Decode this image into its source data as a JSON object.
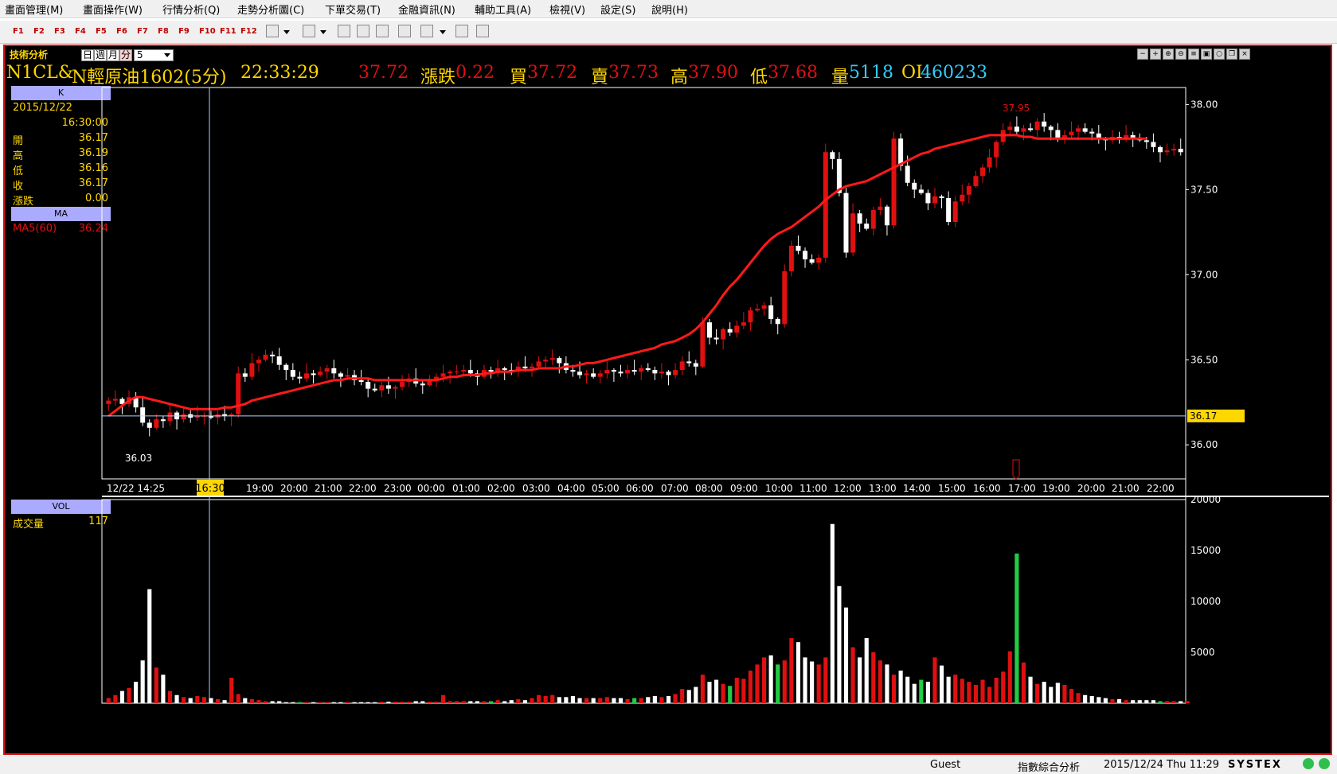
{
  "menu": [
    "畫面管理(M)",
    "畫面操作(W)",
    "行情分析(Q)",
    "走勢分析圖(C)",
    "下單交易(T)",
    "金融資訊(N)",
    "輔助工具(A)",
    "檢視(V)",
    "設定(S)",
    "說明(H)"
  ],
  "fkeys": [
    "F1",
    "F2",
    "F3",
    "F4",
    "F5",
    "F6",
    "F7",
    "F8",
    "F9",
    "F10",
    "F11",
    "F12"
  ],
  "panel_title": "技術分析",
  "timeframes": {
    "day": "日",
    "week": "週",
    "month": "月",
    "minute": "分",
    "interval": "5"
  },
  "quote": {
    "symbol": "N1CL&",
    "name": "N輕原油1602(5分)",
    "time": "22:33:29",
    "price": "37.72",
    "change_label": "漲跌",
    "change": "0.22",
    "bid_label": "買",
    "bid": "37.72",
    "ask_label": "賣",
    "ask": "37.73",
    "high_label": "高",
    "high": "37.90",
    "low_label": "低",
    "low": "37.68",
    "vol_label": "量",
    "vol": "5118",
    "oi_label": "OI",
    "oi": "460233"
  },
  "k_panel": {
    "title": "K",
    "date": "2015/12/22",
    "time": "16:30:00",
    "rows": [
      {
        "label": "開",
        "value": "36.17"
      },
      {
        "label": "高",
        "value": "36.19"
      },
      {
        "label": "低",
        "value": "36.16"
      },
      {
        "label": "收",
        "value": "36.17"
      },
      {
        "label": "漲跌",
        "value": "0.00"
      }
    ]
  },
  "ma_panel": {
    "title": "MA",
    "label": "MA5(60)",
    "value": "36.24"
  },
  "vol_panel": {
    "title": "VOL",
    "label": "成交量",
    "value": "117"
  },
  "status": {
    "user": "Guest",
    "mode": "指數綜合分析",
    "datetime": "2015/12/24 Thu 11:29",
    "brand": "SYSTEX"
  },
  "colors": {
    "up": "#e01010",
    "down": "#ffffff",
    "ma": "#ff1a1a",
    "accent": "#ffd700",
    "frame": "#e01010"
  },
  "chart_data": {
    "type": "candlestick",
    "price_ylim": [
      35.8,
      38.1
    ],
    "price_ticks": [
      "38.00",
      "37.50",
      "37.00",
      "36.50",
      "36.00"
    ],
    "current_price_tag": "36.17",
    "high_marker": "37.95",
    "low_marker": "36.03",
    "x_labels": [
      "12/22 14:25",
      "16:30",
      "19:00",
      "20:00",
      "21:00",
      "22:00",
      "23:00",
      "00:00",
      "01:00",
      "02:00",
      "03:00",
      "04:00",
      "05:00",
      "06:00",
      "07:00",
      "08:00",
      "09:00",
      "10:00",
      "11:00",
      "12:00",
      "13:00",
      "14:00",
      "15:00",
      "16:00",
      "17:00",
      "19:00",
      "20:00",
      "21:00",
      "22:00"
    ],
    "cursor_label": "16:30",
    "close_series": [
      36.26,
      36.27,
      36.24,
      36.28,
      36.22,
      36.13,
      36.1,
      36.15,
      36.14,
      36.19,
      36.15,
      36.18,
      36.16,
      36.17,
      36.17,
      36.16,
      36.18,
      36.17,
      36.18,
      36.42,
      36.4,
      36.48,
      36.5,
      36.53,
      36.52,
      36.47,
      36.44,
      36.4,
      36.39,
      36.42,
      36.41,
      36.43,
      36.45,
      36.42,
      36.4,
      36.41,
      36.38,
      36.37,
      36.33,
      36.32,
      36.35,
      36.33,
      36.34,
      36.37,
      36.39,
      36.36,
      36.35,
      36.38,
      36.4,
      36.42,
      36.43,
      36.43,
      36.44,
      36.42,
      36.4,
      36.44,
      36.43,
      36.45,
      36.44,
      36.43,
      36.46,
      36.45,
      36.46,
      36.49,
      36.5,
      36.51,
      36.48,
      36.44,
      36.43,
      36.41,
      36.42,
      36.4,
      36.42,
      36.44,
      36.43,
      36.42,
      36.44,
      36.43,
      36.45,
      36.44,
      36.42,
      36.43,
      36.41,
      36.44,
      36.49,
      36.48,
      36.46,
      36.72,
      36.63,
      36.62,
      36.68,
      36.66,
      36.7,
      36.72,
      36.79,
      36.8,
      36.82,
      36.74,
      36.71,
      37.02,
      37.17,
      37.14,
      37.09,
      37.07,
      37.1,
      37.72,
      37.68,
      37.48,
      37.13,
      37.36,
      37.3,
      37.27,
      37.38,
      37.4,
      37.29,
      37.8,
      37.64,
      37.54,
      37.5,
      37.48,
      37.42,
      37.46,
      37.45,
      37.31,
      37.43,
      37.47,
      37.52,
      37.58,
      37.63,
      37.69,
      37.78,
      37.85,
      37.87,
      37.84,
      37.86,
      37.85,
      37.9,
      37.87,
      37.85,
      37.8,
      37.82,
      37.84,
      37.86,
      37.84,
      37.83,
      37.8,
      37.79,
      37.81,
      37.8,
      37.82,
      37.8,
      37.79,
      37.78,
      37.75,
      37.72,
      37.73,
      37.74,
      37.72
    ],
    "ma_series": [
      36.17,
      36.2,
      36.23,
      36.26,
      36.28,
      36.28,
      36.27,
      36.26,
      36.25,
      36.24,
      36.23,
      36.22,
      36.21,
      36.21,
      36.21,
      36.21,
      36.21,
      36.22,
      36.22,
      36.23,
      36.24,
      36.26,
      36.27,
      36.28,
      36.29,
      36.3,
      36.31,
      36.32,
      36.33,
      36.34,
      36.35,
      36.36,
      36.37,
      36.38,
      36.38,
      36.39,
      36.39,
      36.39,
      36.39,
      36.38,
      36.38,
      36.38,
      36.38,
      36.38,
      36.38,
      36.38,
      36.38,
      36.38,
      36.38,
      36.39,
      36.4,
      36.4,
      36.41,
      36.41,
      36.41,
      36.42,
      36.42,
      36.43,
      36.43,
      36.43,
      36.44,
      36.44,
      36.44,
      36.45,
      36.45,
      36.45,
      36.45,
      36.46,
      36.46,
      36.47,
      36.48,
      36.48,
      36.49,
      36.5,
      36.51,
      36.52,
      36.53,
      36.54,
      36.55,
      36.56,
      36.57,
      36.59,
      36.6,
      36.61,
      36.63,
      36.65,
      36.68,
      36.72,
      36.77,
      36.82,
      36.88,
      36.93,
      36.97,
      37.02,
      37.07,
      37.12,
      37.17,
      37.21,
      37.24,
      37.26,
      37.28,
      37.31,
      37.34,
      37.37,
      37.4,
      37.44,
      37.47,
      37.5,
      37.52,
      37.53,
      37.54,
      37.55,
      37.57,
      37.59,
      37.61,
      37.63,
      37.65,
      37.67,
      37.69,
      37.71,
      37.72,
      37.74,
      37.75,
      37.76,
      37.77,
      37.78,
      37.79,
      37.8,
      37.81,
      37.82,
      37.82,
      37.82,
      37.82,
      37.82,
      37.81,
      37.81,
      37.8,
      37.8,
      37.8,
      37.8,
      37.8,
      37.8,
      37.8,
      37.8,
      37.8,
      37.8,
      37.8,
      37.8,
      37.8,
      37.8,
      37.8,
      37.8,
      37.8
    ],
    "vol_ylim": [
      0,
      20000
    ],
    "vol_ticks": [
      "20000",
      "15000",
      "10000",
      "5000"
    ],
    "vol_series": [
      500,
      800,
      1200,
      1500,
      2100,
      4200,
      11200,
      3500,
      2800,
      1200,
      800,
      600,
      500,
      700,
      600,
      500,
      400,
      300,
      2500,
      900,
      500,
      400,
      300,
      200,
      200,
      200,
      100,
      100,
      100,
      100,
      100,
      100,
      100,
      100,
      100,
      100,
      100,
      100,
      100,
      100,
      150,
      150,
      150,
      150,
      150,
      200,
      200,
      150,
      150,
      800,
      200,
      200,
      200,
      200,
      200,
      200,
      200,
      300,
      200,
      300,
      400,
      300,
      500,
      800,
      700,
      800,
      600,
      600,
      700,
      500,
      500,
      500,
      500,
      600,
      500,
      500,
      400,
      500,
      500,
      600,
      700,
      600,
      700,
      900,
      1400,
      1300,
      1600,
      2800,
      2100,
      2300,
      1900,
      1700,
      2500,
      2400,
      3200,
      3800,
      4500,
      4700,
      3800,
      4200,
      6400,
      6000,
      4500,
      4100,
      3800,
      4500,
      17600,
      11500,
      9400,
      5500,
      4500,
      6400,
      5000,
      4200,
      3800,
      2800,
      3200,
      2600,
      1900,
      2300,
      2100,
      4500,
      3700,
      2600,
      2800,
      2400,
      2100,
      1800,
      2300,
      1600,
      2500,
      3100,
      5100,
      14700,
      4000,
      2600,
      1900,
      2100,
      1600,
      2000,
      1800,
      1400,
      1000,
      800,
      700,
      600,
      500,
      400,
      400,
      300,
      300,
      300,
      300,
      300,
      200,
      200,
      200,
      200,
      200
    ]
  }
}
